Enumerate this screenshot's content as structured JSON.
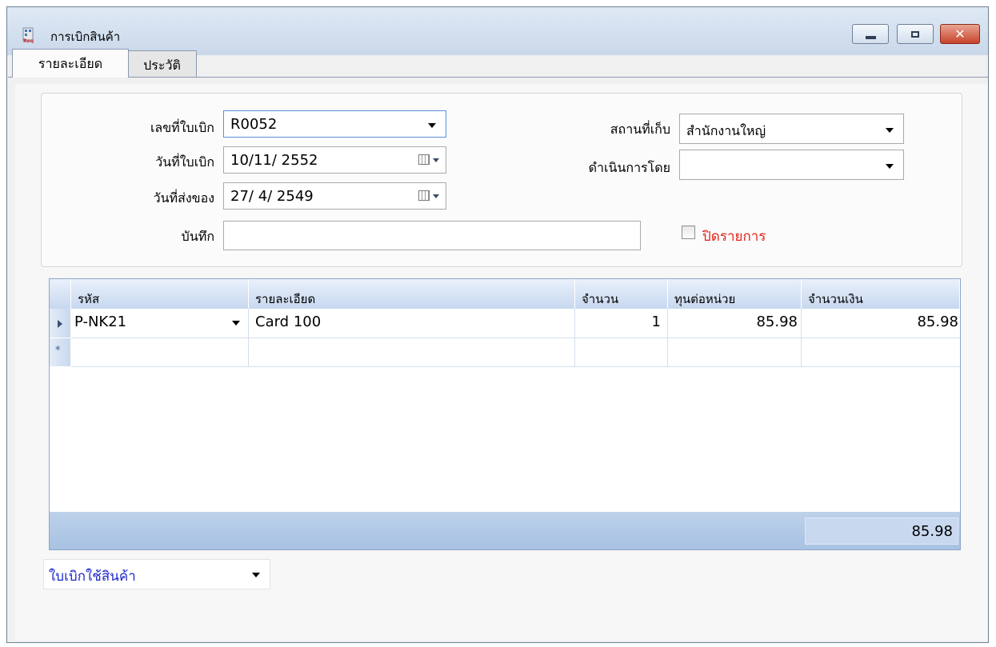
{
  "window": {
    "title": "การเบิกสินค้า",
    "controls": {
      "minimize": "minimize-icon",
      "maximize": "maximize-icon",
      "close": "close-icon"
    }
  },
  "tabs": [
    {
      "label": "รายละเอียด",
      "active": true
    },
    {
      "label": "ประวัติ",
      "active": false
    }
  ],
  "form": {
    "requisition_no_label": "เลขที่ใบเบิก",
    "requisition_no_value": "R0052",
    "requisition_date_label": "วันที่ใบเบิก",
    "requisition_date_value": "10/11/ 2552",
    "delivery_date_label": "วันที่ส่งของ",
    "delivery_date_value": "27/ 4/ 2549",
    "note_label": "บันทึก",
    "note_value": "",
    "location_label": "สถานที่เก็บ",
    "location_value": "สำนักงานใหญ่",
    "operated_by_label": "ดำเนินการโดย",
    "operated_by_value": "",
    "close_item_label": "ปิดรายการ",
    "close_item_checked": false
  },
  "grid": {
    "columns": [
      "รหัส",
      "รายละเอียด",
      "จำนวน",
      "ทุนต่อหน่วย",
      "จำนวนเงิน"
    ],
    "rows": [
      {
        "code": "P-NK21",
        "description": "Card 100",
        "qty": "1",
        "unit_cost": "85.98",
        "amount": "85.98"
      }
    ],
    "new_row_marker": "*",
    "total": "85.98"
  },
  "doc_type": {
    "value": "ใบเบิกใช้สินค้า"
  },
  "colors": {
    "accent_red": "#e3241b",
    "combo_text_blue": "#1d28c9",
    "grid_header": "#c7d8ef"
  }
}
